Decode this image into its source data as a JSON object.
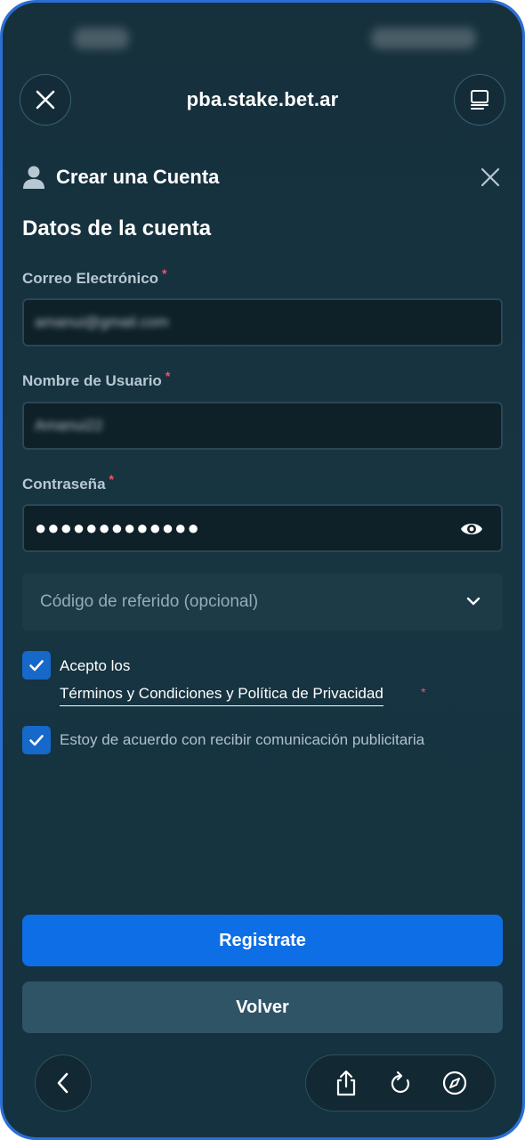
{
  "browser": {
    "url": "pba.stake.bet.ar"
  },
  "modal": {
    "title": "Crear una Cuenta",
    "section_title": "Datos de la cuenta"
  },
  "form": {
    "email": {
      "label": "Correo Electrónico",
      "value": "amanui@gmail.com"
    },
    "username": {
      "label": "Nombre de Usuario",
      "value": "Amanui22"
    },
    "password": {
      "label": "Contraseña",
      "value": "●●●●●●●●●●●●●"
    },
    "required_mark": "*",
    "referral": {
      "placeholder": "Código de referido (opcional)"
    },
    "terms": {
      "checked": true,
      "label": "Acepto los",
      "link": "Términos y Condiciones y Política de Privacidad"
    },
    "marketing": {
      "checked": true,
      "label": "Estoy de acuerdo con recibir comunicación publicitaria"
    }
  },
  "buttons": {
    "register": "Registrate",
    "back": "Volver"
  },
  "icons": {
    "browser_close": "close-icon",
    "tabs": "tabs-icon",
    "user": "user-icon",
    "modal_close": "close-icon",
    "eye": "eye-icon",
    "chevron": "chevron-down-icon",
    "check": "check-icon",
    "nav_back": "chevron-left-icon",
    "share": "share-icon",
    "reload": "reload-icon",
    "compass": "compass-icon"
  },
  "colors": {
    "primary": "#0d6ee6",
    "secondary": "#2f5466",
    "required": "#ff4d6a",
    "checkbox": "#1668c9"
  }
}
